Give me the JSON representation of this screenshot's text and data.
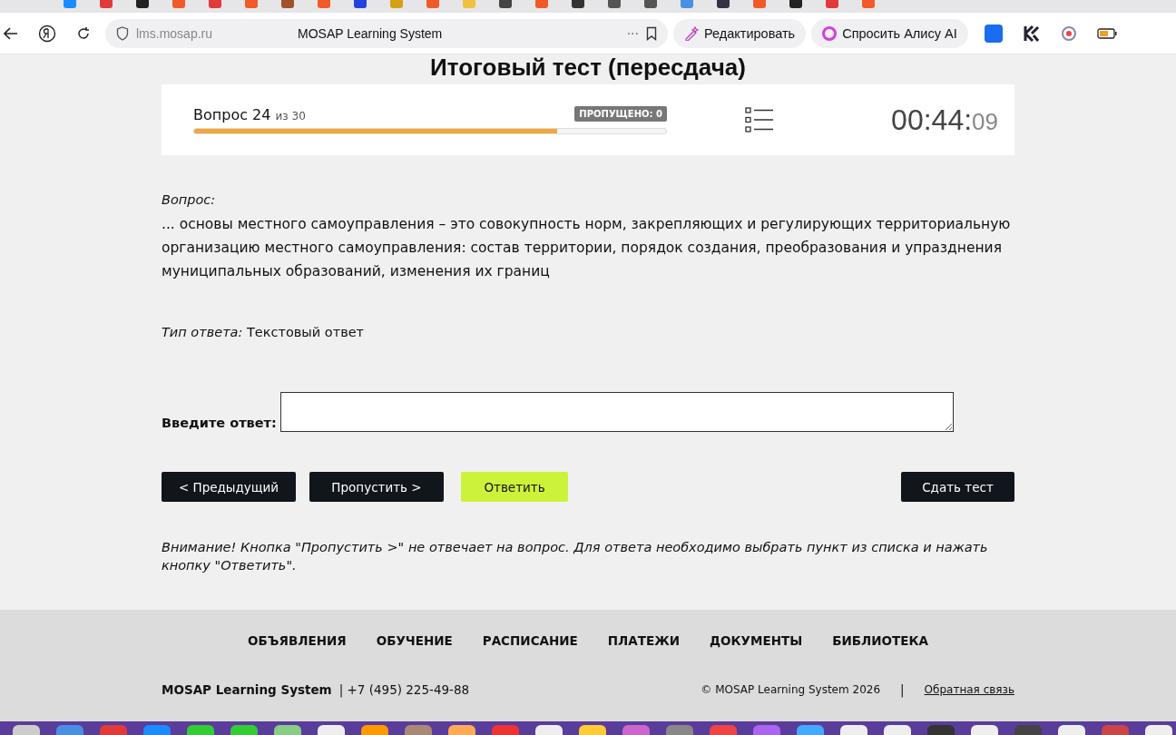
{
  "browser": {
    "address": "lms.mosap.ru",
    "page_title": "MOSAP Learning System",
    "more": "···",
    "edit_button": "Редактировать",
    "alice_button": "Спросить Алису AI"
  },
  "page_title": "Итоговый тест (пересдача)",
  "progress": {
    "label": "Вопрос 24",
    "of": "из 30",
    "level": 0.77,
    "skipped": "ПРОПУЩЕНО: 0",
    "timer_main": "00:44:",
    "timer_sec": "09"
  },
  "question": {
    "label": "Вопрос:",
    "text": "... основы местного самоуправления – это совокупность норм, закрепляющих и регулирующих территориальную организацию местного самоуправления: состав территории, порядок создания, преобразования и упразднения муниципальных образований, изменения их границ"
  },
  "answer_type": {
    "label": "Тип ответа:",
    "value": "Текстовый ответ"
  },
  "answer": {
    "label": "Введите ответ:"
  },
  "buttons": [
    {
      "label": "< Предыдущий",
      "kind": "dark"
    },
    {
      "label": "Пропустить >",
      "kind": "dark"
    },
    {
      "label": "Ответить",
      "kind": "accent"
    },
    {
      "label": "Сдать тест",
      "kind": "dark-right"
    }
  ],
  "notice": "Внимание! Кнопка \"Пропустить >\" не отвечает на вопрос. Для ответа необходимо выбрать пункт из списка и нажать кнопку \"Ответить\".",
  "footer": {
    "nav": [
      "ОБЪЯВЛЕНИЯ",
      "ОБУЧЕНИЕ",
      "РАСПИСАНИЕ",
      "ПЛАТЕЖИ",
      "ДОКУМЕНТЫ",
      "БИБЛИОТЕКА"
    ],
    "brand": "MOSAP Learning System",
    "phone": "| +7 (495) 225-49-88",
    "copyright": "© MOSAP Learning System 2026",
    "separator": "|",
    "feedback": "Обратная связь"
  }
}
